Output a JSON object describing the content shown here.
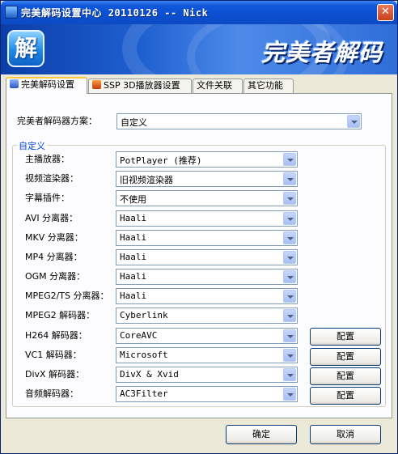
{
  "window": {
    "title": "完美解码设置中心 20110126 -- Nick",
    "close_glyph": "✕"
  },
  "banner": {
    "logo_char": "解",
    "title": "完美者解码"
  },
  "tabs": [
    {
      "label": "完美解码设置",
      "active": true
    },
    {
      "label": "SSP 3D播放器设置",
      "active": false
    },
    {
      "label": "文件关联",
      "active": false
    },
    {
      "label": "其它功能",
      "active": false
    }
  ],
  "scheme": {
    "label": "完美者解码器方案：",
    "value": "自定义"
  },
  "custom_group": {
    "title": "自定义",
    "rows": [
      {
        "label": "主播放器：",
        "value": "PotPlayer (推荐)"
      },
      {
        "label": "视频渲染器：",
        "value": "旧视频渲染器"
      },
      {
        "label": "字幕插件：",
        "value": "不使用"
      },
      {
        "label": "AVI 分离器：",
        "value": "Haali"
      },
      {
        "label": "MKV 分离器：",
        "value": "Haali"
      },
      {
        "label": "MP4 分离器：",
        "value": "Haali"
      },
      {
        "label": "OGM 分离器：",
        "value": "Haali"
      },
      {
        "label": "MPEG2/TS 分离器：",
        "value": "Haali"
      },
      {
        "label": "MPEG2 解码器：",
        "value": "Cyberlink"
      },
      {
        "label": "H264 解码器：",
        "value": "CoreAVC",
        "config": "配置"
      },
      {
        "label": "VC1 解码器：",
        "value": "Microsoft",
        "config": "配置"
      },
      {
        "label": "DivX 解码器：",
        "value": "DivX & Xvid",
        "config": "配置"
      },
      {
        "label": "音频解码器：",
        "value": "AC3Filter",
        "config": "配置"
      }
    ]
  },
  "footer": {
    "ok_label": "确定",
    "cancel_label": "取消"
  }
}
